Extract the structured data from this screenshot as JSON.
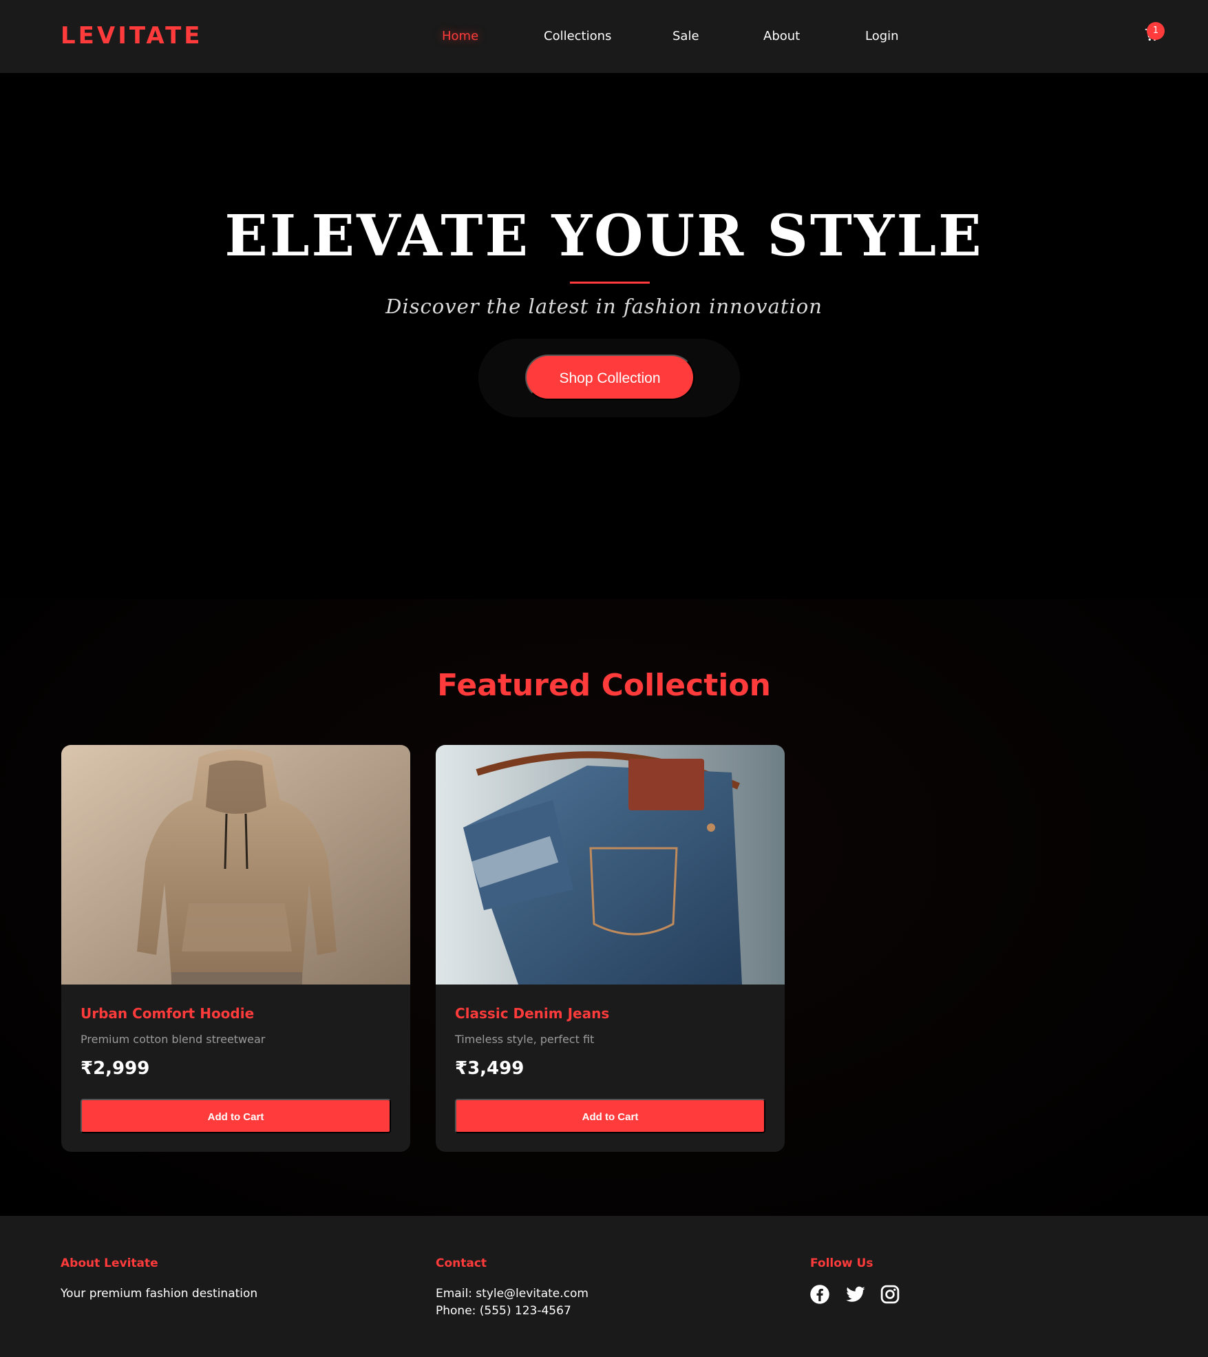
{
  "brand": {
    "logo": "LEVITATE",
    "accent": "#ff3b3b"
  },
  "nav": {
    "items": [
      {
        "label": "Home",
        "active": true
      },
      {
        "label": "Collections",
        "active": false
      },
      {
        "label": "Sale",
        "active": false
      },
      {
        "label": "About",
        "active": false
      },
      {
        "label": "Login",
        "active": false
      }
    ],
    "cart_count": "1",
    "cart_icon": "shopping-cart-icon"
  },
  "hero": {
    "title": "ELEVATE YOUR STYLE",
    "subtitle": "Discover the latest in fashion innovation",
    "cta_label": "Shop Collection"
  },
  "featured": {
    "heading": "Featured Collection",
    "products": [
      {
        "name": "Urban Comfort Hoodie",
        "description": "Premium cotton blend streetwear",
        "price": "₹2,999",
        "button_label": "Add to Cart"
      },
      {
        "name": "Classic Denim Jeans",
        "description": "Timeless style, perfect fit",
        "price": "₹3,499",
        "button_label": "Add to Cart"
      }
    ]
  },
  "footer": {
    "about": {
      "heading": "About Levitate",
      "text": "Your premium fashion destination"
    },
    "contact": {
      "heading": "Contact",
      "email": "Email: style@levitate.com",
      "phone": "Phone: (555) 123-4567"
    },
    "follow": {
      "heading": "Follow Us",
      "icons": [
        "facebook-icon",
        "twitter-icon",
        "instagram-icon"
      ]
    }
  }
}
